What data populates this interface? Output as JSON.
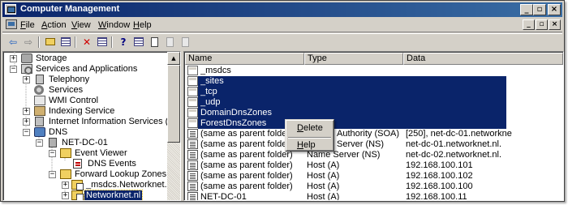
{
  "window": {
    "title": "Computer Management",
    "caption_buttons": {
      "minimize": "_",
      "restore": "▫",
      "close": "×"
    }
  },
  "menubar": {
    "items": [
      {
        "label": "File"
      },
      {
        "label": "Action"
      },
      {
        "label": "View"
      },
      {
        "label": "Window"
      },
      {
        "label": "Help"
      }
    ],
    "mdi_buttons": {
      "minimize": "_",
      "restore": "▫",
      "close": "×"
    }
  },
  "toolbar": {
    "buttons": [
      {
        "name": "back",
        "icon": "arrow-left-icon",
        "glyph": "⇦",
        "color": "#2060c0"
      },
      {
        "name": "forward",
        "icon": "arrow-right-icon",
        "glyph": "⇨",
        "color": "#808080"
      },
      {
        "name": "up",
        "icon": "folder-up-icon"
      },
      {
        "name": "show-hide-tree",
        "icon": "console-tree-icon"
      },
      {
        "name": "delete",
        "icon": "delete-icon",
        "glyph": "✕",
        "color": "#d00000"
      },
      {
        "name": "properties",
        "icon": "properties-icon"
      },
      {
        "name": "help",
        "icon": "help-icon",
        "glyph": "?",
        "color": "#000080"
      },
      {
        "name": "list-view",
        "icon": "list-view-icon"
      },
      {
        "name": "doc-1",
        "icon": "document-icon"
      },
      {
        "name": "doc-2",
        "icon": "document-icon"
      },
      {
        "name": "doc-3",
        "icon": "document-icon"
      }
    ]
  },
  "tree": {
    "items": [
      {
        "label": "Storage",
        "icon": "storage-icon",
        "expander": "+"
      },
      {
        "label": "Services and Applications",
        "icon": "services-icon",
        "expander": "−"
      },
      {
        "label": "Telephony",
        "icon": "telephony-icon",
        "expander": "+"
      },
      {
        "label": "Services",
        "icon": "services-gear-icon",
        "expander": ""
      },
      {
        "label": "WMI Control",
        "icon": "wmi-icon",
        "expander": ""
      },
      {
        "label": "Indexing Service",
        "icon": "indexing-icon",
        "expander": "+"
      },
      {
        "label": "Internet Information Services (IIS) Mar",
        "icon": "iis-icon",
        "expander": "+"
      },
      {
        "label": "DNS",
        "icon": "dns-icon",
        "expander": "−"
      },
      {
        "label": "NET-DC-01",
        "icon": "server-icon",
        "expander": "−"
      },
      {
        "label": "Event Viewer",
        "icon": "event-viewer-icon",
        "expander": "−"
      },
      {
        "label": "DNS Events",
        "icon": "event-log-icon",
        "expander": ""
      },
      {
        "label": "Forward Lookup Zones",
        "icon": "folder-icon",
        "expander": "−"
      },
      {
        "label": "_msdcs.Networknet.nl",
        "icon": "zone-icon",
        "expander": "+"
      },
      {
        "label": "Networknet.nl",
        "icon": "zone-icon",
        "expander": "+",
        "selected": true
      }
    ]
  },
  "list": {
    "columns": [
      "Name",
      "Type",
      "Data"
    ],
    "rows": [
      {
        "name": "_msdcs",
        "type": "",
        "data": "",
        "icon": "folder-icon",
        "selected": false
      },
      {
        "name": "_sites",
        "type": "",
        "data": "",
        "icon": "folder-icon",
        "selected": true
      },
      {
        "name": "_tcp",
        "type": "",
        "data": "",
        "icon": "folder-icon",
        "selected": true
      },
      {
        "name": "_udp",
        "type": "",
        "data": "",
        "icon": "folder-icon",
        "selected": true
      },
      {
        "name": "DomainDnsZones",
        "type": "",
        "data": "",
        "icon": "folder-icon",
        "selected": true
      },
      {
        "name": "ForestDnsZones",
        "type": "",
        "data": "",
        "icon": "folder-icon",
        "selected": true
      },
      {
        "name": "(same as parent folder)",
        "type": "Authority (SOA)",
        "data": "[250], net-dc-01.networkne",
        "icon": "record-icon",
        "selected": false
      },
      {
        "name": "(same as parent folder)",
        "type": "Server (NS)",
        "data": "net-dc-01.networknet.nl.",
        "icon": "record-icon",
        "selected": false
      },
      {
        "name": "(same as parent folder)",
        "type": "Name Server (NS)",
        "data": "net-dc-02.networknet.nl.",
        "icon": "record-icon",
        "selected": false
      },
      {
        "name": "(same as parent folder)",
        "type": "Host (A)",
        "data": "192.168.100.101",
        "icon": "record-icon",
        "selected": false
      },
      {
        "name": "(same as parent folder)",
        "type": "Host (A)",
        "data": "192.168.100.102",
        "icon": "record-icon",
        "selected": false
      },
      {
        "name": "(same as parent folder)",
        "type": "Host (A)",
        "data": "192.168.100.100",
        "icon": "record-icon",
        "selected": false
      },
      {
        "name": "NET-DC-01",
        "type": "Host (A)",
        "data": "192.168.100.11",
        "icon": "record-icon",
        "selected": false
      }
    ]
  },
  "context_menu": {
    "items": [
      {
        "label": "Delete"
      },
      {
        "label": "Help"
      }
    ]
  },
  "colors": {
    "title_bar_start": "#0a246a",
    "title_bar_end": "#3a6ea5",
    "selection": "#0a246a",
    "chrome": "#d4d0c8"
  }
}
